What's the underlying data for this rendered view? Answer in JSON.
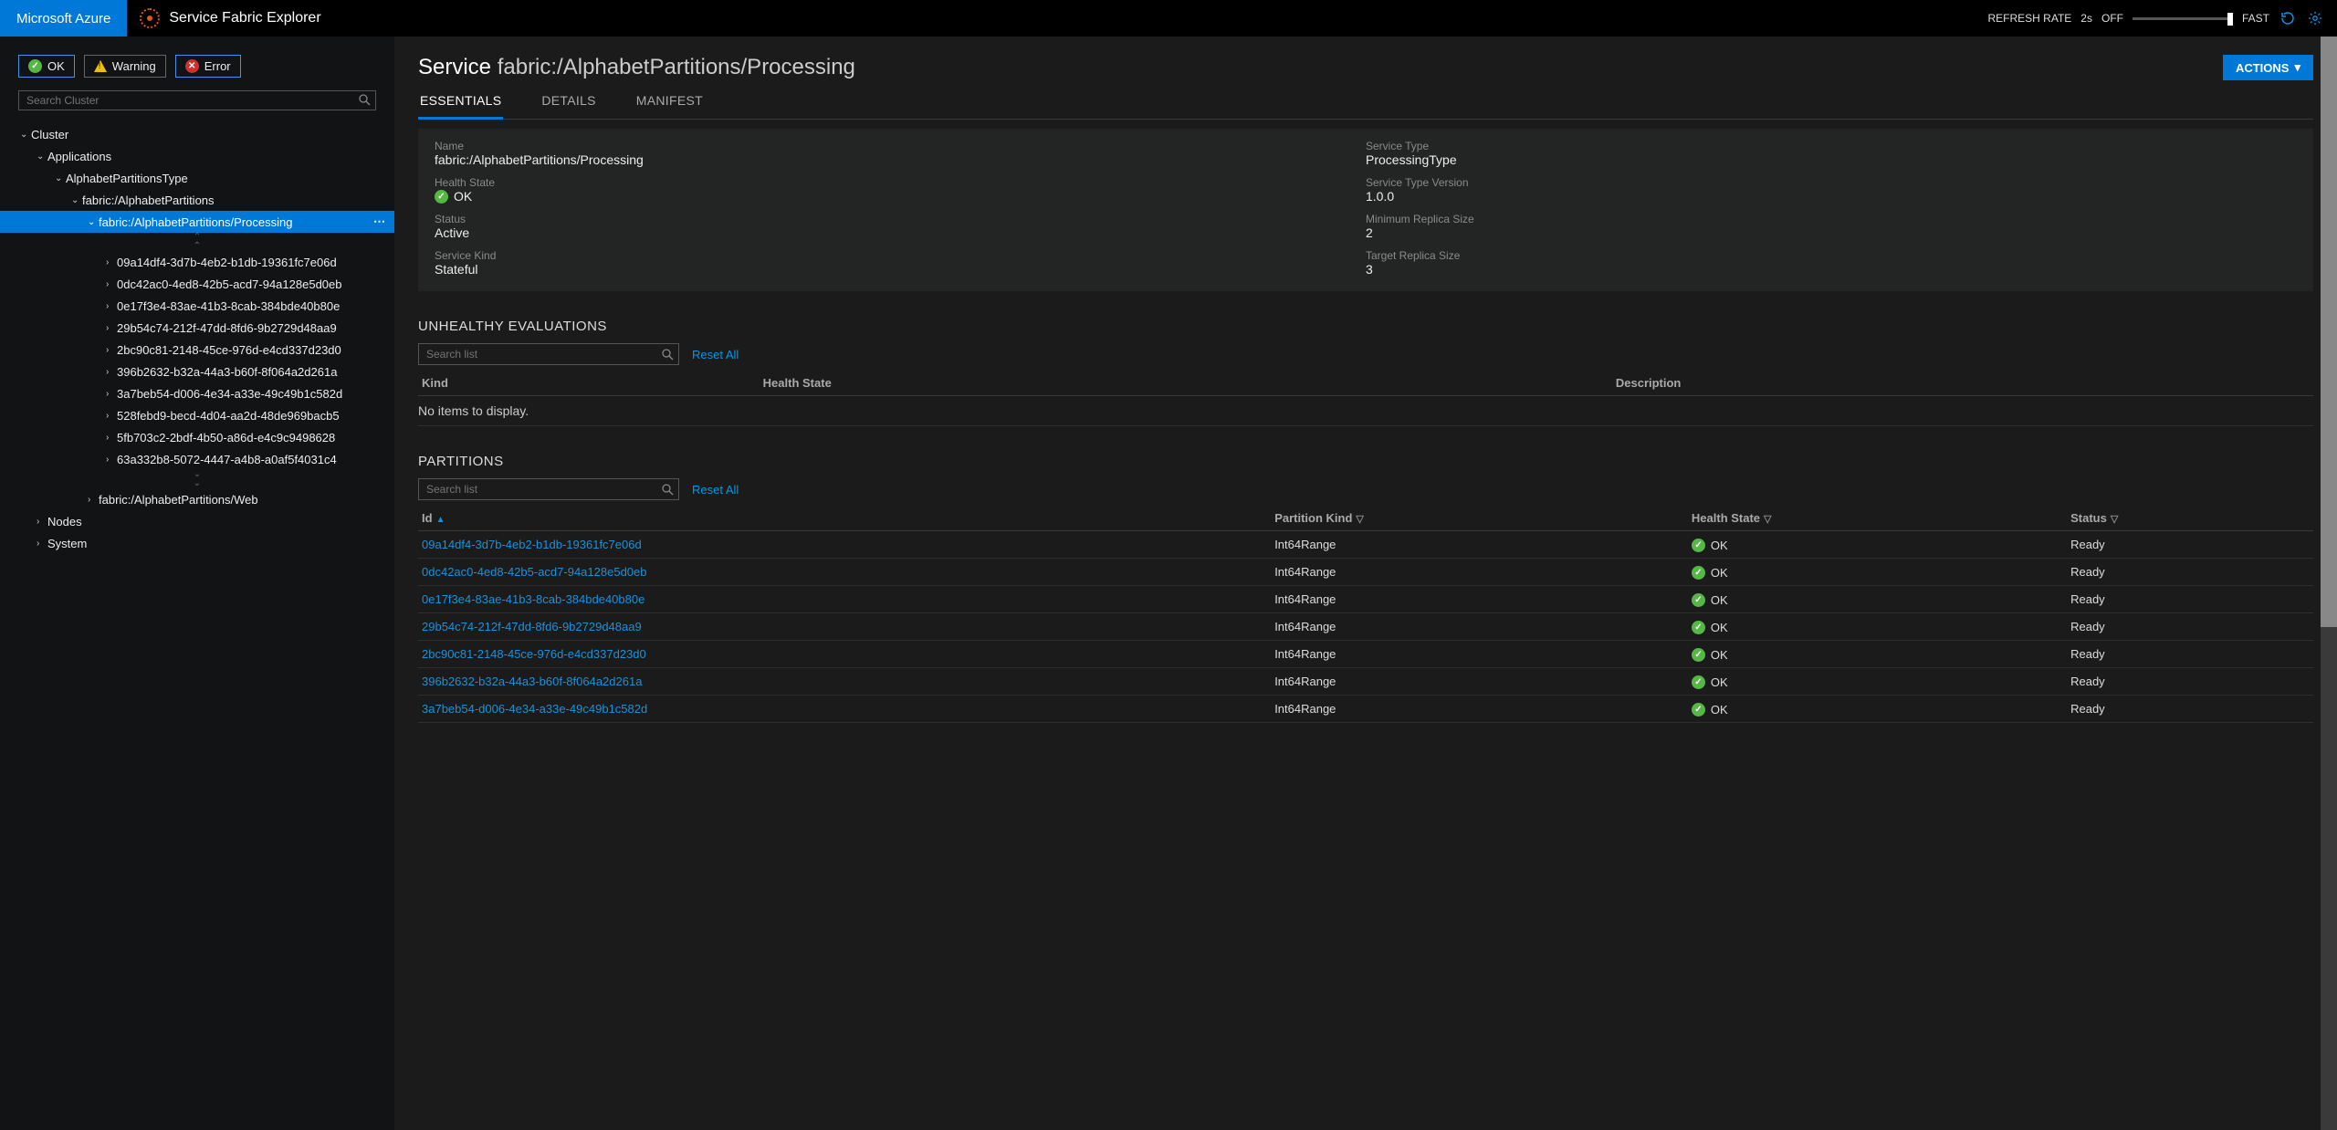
{
  "topbar": {
    "azure": "Microsoft Azure",
    "app": "Service Fabric Explorer",
    "refresh_label": "REFRESH RATE",
    "refresh_value": "2s",
    "off": "OFF",
    "fast": "FAST"
  },
  "filters": {
    "ok": "OK",
    "warning": "Warning",
    "error": "Error"
  },
  "search": {
    "cluster_placeholder": "Search Cluster",
    "list_placeholder": "Search list",
    "reset": "Reset All"
  },
  "tree": {
    "root": "Cluster",
    "applications": "Applications",
    "appType": "AlphabetPartitionsType",
    "app": "fabric:/AlphabetPartitions",
    "service_processing": "fabric:/AlphabetPartitions/Processing",
    "service_web": "fabric:/AlphabetPartitions/Web",
    "nodes": "Nodes",
    "system": "System",
    "partitions": [
      "09a14df4-3d7b-4eb2-b1db-19361fc7e06d",
      "0dc42ac0-4ed8-42b5-acd7-94a128e5d0eb",
      "0e17f3e4-83ae-41b3-8cab-384bde40b80e",
      "29b54c74-212f-47dd-8fd6-9b2729d48aa9",
      "2bc90c81-2148-45ce-976d-e4cd337d23d0",
      "396b2632-b32a-44a3-b60f-8f064a2d261a",
      "3a7beb54-d006-4e34-a33e-49c49b1c582d",
      "528febd9-becd-4d04-aa2d-48de969bacb5",
      "5fb703c2-2bdf-4b50-a86d-e4c9c9498628",
      "63a332b8-5072-4447-a4b8-a0af5f4031c4"
    ]
  },
  "page": {
    "kind": "Service",
    "name": "fabric:/AlphabetPartitions/Processing",
    "actions": "ACTIONS"
  },
  "tabs": {
    "essentials": "ESSENTIALS",
    "details": "DETAILS",
    "manifest": "MANIFEST"
  },
  "essentials": {
    "name_label": "Name",
    "name_value": "fabric:/AlphabetPartitions/Processing",
    "svc_type_label": "Service Type",
    "svc_type_value": "ProcessingType",
    "health_label": "Health State",
    "health_value": "OK",
    "svc_ver_label": "Service Type Version",
    "svc_ver_value": "1.0.0",
    "status_label": "Status",
    "status_value": "Active",
    "min_rep_label": "Minimum Replica Size",
    "min_rep_value": "2",
    "kind_label": "Service Kind",
    "kind_value": "Stateful",
    "tgt_rep_label": "Target Replica Size",
    "tgt_rep_value": "3"
  },
  "sections": {
    "unhealthy": "UNHEALTHY EVALUATIONS",
    "partitions": "PARTITIONS",
    "no_items": "No items to display."
  },
  "unhealthy_cols": {
    "kind": "Kind",
    "health": "Health State",
    "desc": "Description"
  },
  "partitions_cols": {
    "id": "Id",
    "pkind": "Partition Kind",
    "health": "Health State",
    "status": "Status"
  },
  "partitions": [
    {
      "id": "09a14df4-3d7b-4eb2-b1db-19361fc7e06d",
      "kind": "Int64Range",
      "health": "OK",
      "status": "Ready"
    },
    {
      "id": "0dc42ac0-4ed8-42b5-acd7-94a128e5d0eb",
      "kind": "Int64Range",
      "health": "OK",
      "status": "Ready"
    },
    {
      "id": "0e17f3e4-83ae-41b3-8cab-384bde40b80e",
      "kind": "Int64Range",
      "health": "OK",
      "status": "Ready"
    },
    {
      "id": "29b54c74-212f-47dd-8fd6-9b2729d48aa9",
      "kind": "Int64Range",
      "health": "OK",
      "status": "Ready"
    },
    {
      "id": "2bc90c81-2148-45ce-976d-e4cd337d23d0",
      "kind": "Int64Range",
      "health": "OK",
      "status": "Ready"
    },
    {
      "id": "396b2632-b32a-44a3-b60f-8f064a2d261a",
      "kind": "Int64Range",
      "health": "OK",
      "status": "Ready"
    },
    {
      "id": "3a7beb54-d006-4e34-a33e-49c49b1c582d",
      "kind": "Int64Range",
      "health": "OK",
      "status": "Ready"
    }
  ]
}
